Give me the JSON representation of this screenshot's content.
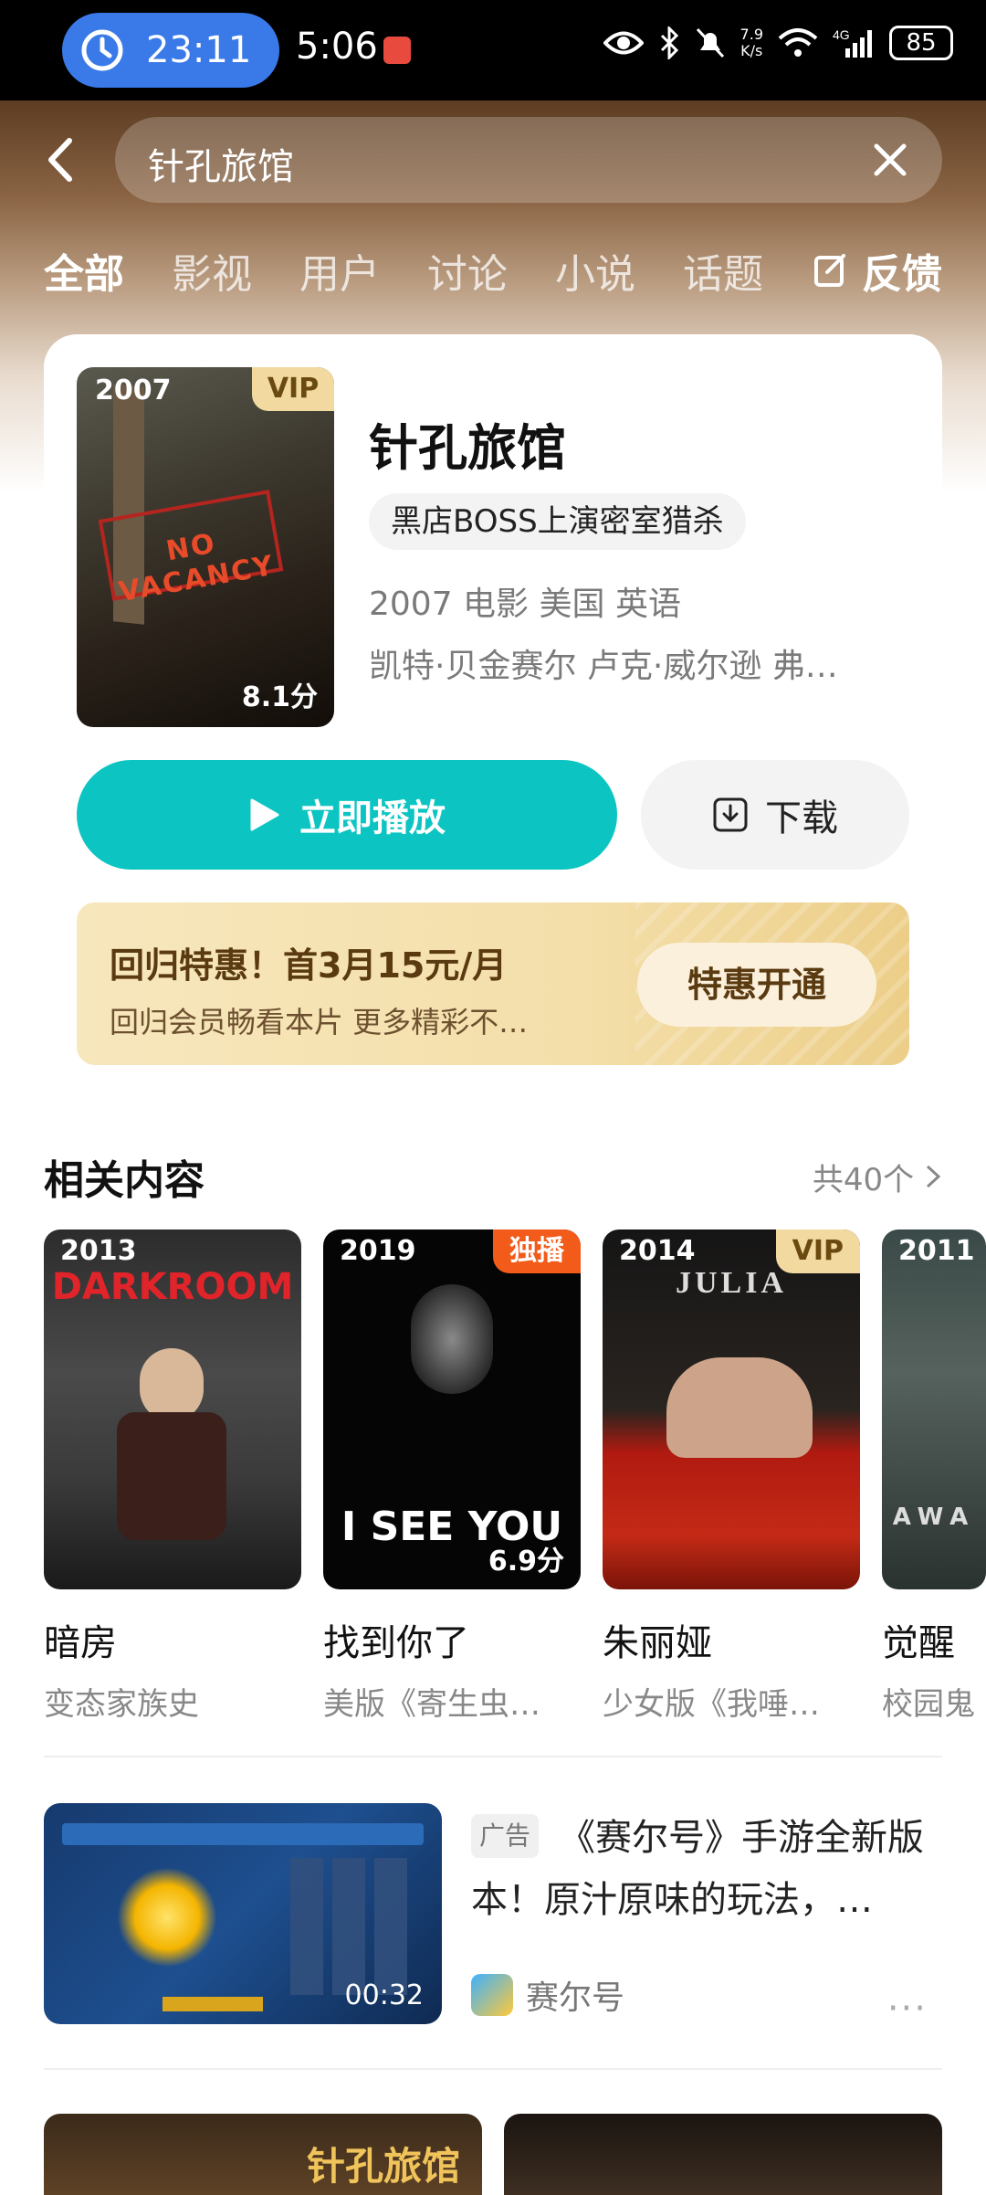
{
  "status_bar": {
    "timer": "23:11",
    "time": "5:06",
    "net_speed_value": "7.9",
    "net_speed_unit": "K/s",
    "network": "4G",
    "battery": "85"
  },
  "search": {
    "query": "针孔旅馆"
  },
  "tabs": [
    "全部",
    "影视",
    "用户",
    "讨论",
    "小说",
    "话题"
  ],
  "active_tab": "全部",
  "feedback_label": "反馈",
  "movie": {
    "year": "2007",
    "badge": "VIP",
    "score": "8.1分",
    "poster_sign": "NO VACANCY",
    "title": "针孔旅馆",
    "tagline": "黑店BOSS上演密室猎杀",
    "meta": "2007 电影 美国 英语",
    "cast": "凯特·贝金赛尔 卢克·威尔逊 弗…",
    "play_label": "立即播放",
    "download_label": "下载"
  },
  "promo": {
    "headline": "回归特惠！首3月15元/月",
    "subtext": "回归会员畅看本片 更多精彩不…",
    "button_label": "特惠开通"
  },
  "related": {
    "title": "相关内容",
    "count_label": "共40个",
    "items": [
      {
        "year": "2013",
        "badge": "",
        "score": "",
        "poster_text": "DARKROOM",
        "name": "暗房",
        "sub": "变态家族史"
      },
      {
        "year": "2019",
        "badge": "独播",
        "score": "6.9分",
        "poster_text": "I SEE YOU",
        "name": "找到你了",
        "sub": "美版《寄生虫…"
      },
      {
        "year": "2014",
        "badge": "VIP",
        "score": "",
        "poster_text": "JULIA",
        "name": "朱丽娅",
        "sub": "少女版《我唾…"
      },
      {
        "year": "2011",
        "badge": "",
        "score": "",
        "poster_text": "AWA",
        "name": "觉醒",
        "sub": "校园鬼"
      }
    ]
  },
  "ad": {
    "tag": "广告",
    "text": "《赛尔号》手游全新版本！原汁原味的玩法，…",
    "brand": "赛尔号",
    "duration": "00:32",
    "more": "···"
  },
  "bottom_cards": [
    {
      "text": "针孔旅馆"
    },
    {
      "text": ""
    }
  ],
  "colors": {
    "accent_teal": "#0cc5c3",
    "vip_gold": "#f1d9a0",
    "exclusive_orange": "#f25b1a"
  }
}
